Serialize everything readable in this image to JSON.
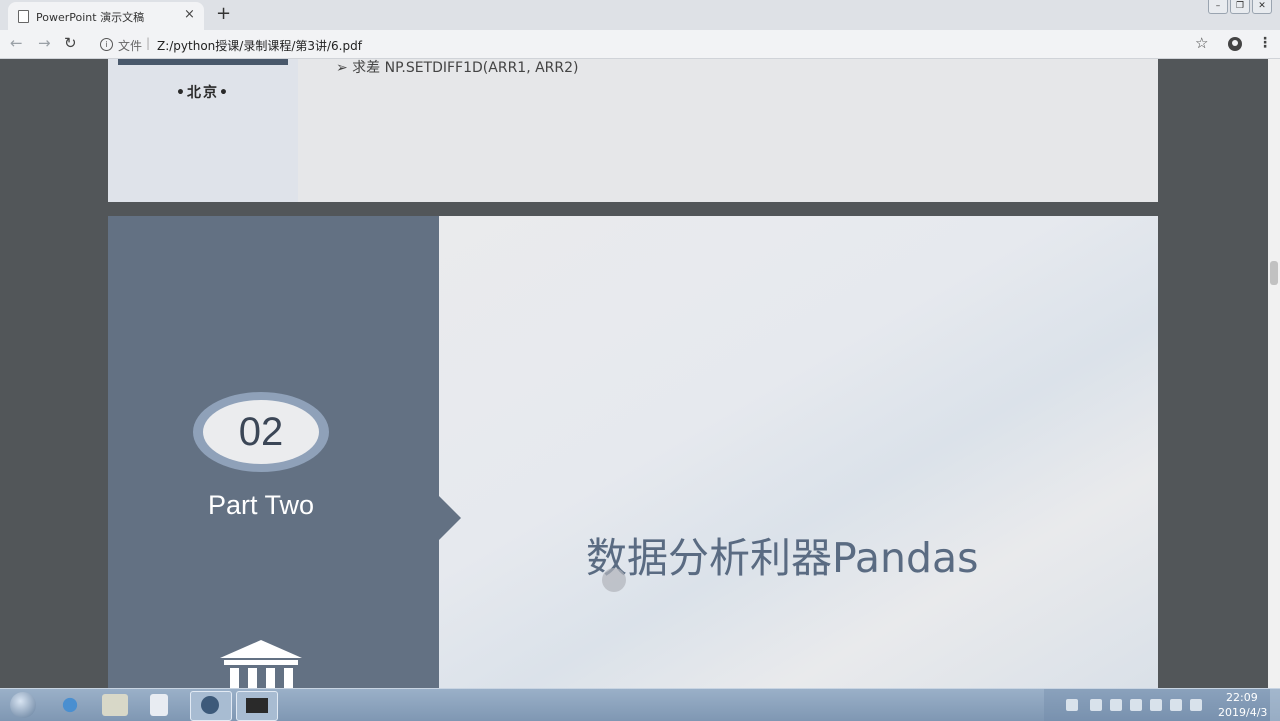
{
  "browser": {
    "tab_title": "PowerPoint 演示文稿",
    "tab_close": "×",
    "new_tab": "+",
    "address_label": "文件",
    "address_sep": "|",
    "url": "Z:/python授课/录制课程/第3讲/6.pdf",
    "window_buttons": [
      "–",
      "❐",
      "✕"
    ]
  },
  "page1": {
    "city": "•北京•",
    "bullet_line": "➢  求差  NP.SETDIFF1D(ARR1, ARR2)"
  },
  "page2": {
    "number": "02",
    "part_label": "Part Two",
    "title": "数据分析利器Pandas"
  },
  "taskbar": {
    "time": "22:09",
    "date": "2019/4/3"
  },
  "colors": {
    "slide_sidebar": "#637183",
    "slide_title": "#5a6b82",
    "taskbar": "#8aa2bd"
  }
}
